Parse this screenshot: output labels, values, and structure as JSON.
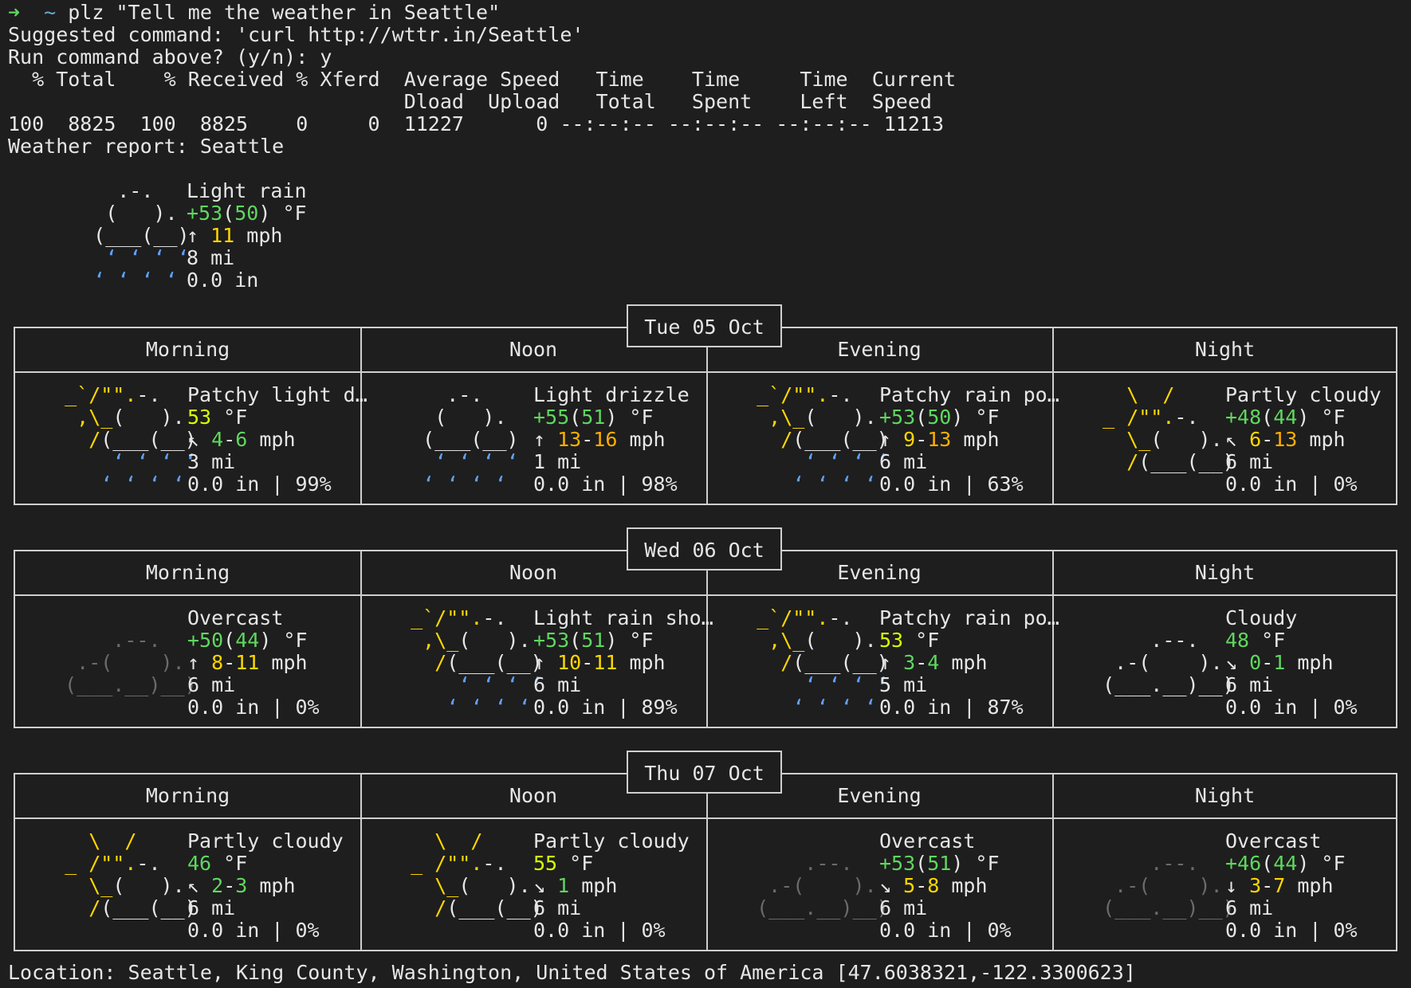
{
  "cmd": {
    "arrow": "➜",
    "tilde": "~",
    "command": "plz \"Tell me the weather in Seattle\"",
    "suggested": "Suggested command: 'curl http://wttr.in/Seattle'",
    "run": "Run command above? (y/n): y"
  },
  "curl": {
    "header1": "  % Total    % Received % Xferd  Average Speed   Time    Time     Time  Current",
    "header2": "                                 Dload  Upload   Total   Spent    Left  Speed",
    "stats": "100  8825  100  8825    0     0  11227      0 --:--:-- --:--:-- --:--:-- 11213"
  },
  "report_title": "Weather report: Seattle",
  "current": {
    "condition": "Light rain",
    "temp": "+53",
    "feels": "50",
    "unit": "°F",
    "wind_arrow": "↑",
    "wind": "11",
    "wind_unit": "mph",
    "visibility": "8 mi",
    "precip": "0.0 in"
  },
  "periods": [
    "Morning",
    "Noon",
    "Evening",
    "Night"
  ],
  "days": [
    {
      "date": "Tue 05 Oct",
      "slots": [
        {
          "condition": "Patchy light d…",
          "temp": "53",
          "feels": "",
          "wind_arrow": "↖",
          "wind_lo": "4",
          "wind_hi": "6",
          "visibility": "3 mi",
          "precip": "0.0 in | 99%"
        },
        {
          "condition": "Light drizzle",
          "temp": "+55",
          "feels": "51",
          "wind_arrow": "↑",
          "wind_lo": "13",
          "wind_hi": "16",
          "visibility": "1 mi",
          "precip": "0.0 in | 98%"
        },
        {
          "condition": "Patchy rain po…",
          "temp": "+53",
          "feels": "50",
          "wind_arrow": "↑",
          "wind_lo": "9",
          "wind_hi": "13",
          "visibility": "6 mi",
          "precip": "0.0 in | 63%"
        },
        {
          "condition": "Partly cloudy",
          "temp": "+48",
          "feels": "44",
          "wind_arrow": "↖",
          "wind_lo": "6",
          "wind_hi": "13",
          "visibility": "6 mi",
          "precip": "0.0 in | 0%"
        }
      ]
    },
    {
      "date": "Wed 06 Oct",
      "slots": [
        {
          "condition": "Overcast",
          "temp": "+50",
          "feels": "44",
          "wind_arrow": "↑",
          "wind_lo": "8",
          "wind_hi": "11",
          "visibility": "6 mi",
          "precip": "0.0 in | 0%"
        },
        {
          "condition": "Light rain sho…",
          "temp": "+53",
          "feels": "51",
          "wind_arrow": "↑",
          "wind_lo": "10",
          "wind_hi": "11",
          "visibility": "6 mi",
          "precip": "0.0 in | 89%"
        },
        {
          "condition": "Patchy rain po…",
          "temp": "53",
          "feels": "",
          "wind_arrow": "↑",
          "wind_lo": "3",
          "wind_hi": "4",
          "visibility": "5 mi",
          "precip": "0.0 in | 87%"
        },
        {
          "condition": "Cloudy",
          "temp": "48",
          "feels": "",
          "wind_arrow": "↘",
          "wind_lo": "0",
          "wind_hi": "1",
          "visibility": "6 mi",
          "precip": "0.0 in | 0%"
        }
      ]
    },
    {
      "date": "Thu 07 Oct",
      "slots": [
        {
          "condition": "Partly cloudy",
          "temp": "46",
          "feels": "",
          "wind_arrow": "↖",
          "wind_lo": "2",
          "wind_hi": "3",
          "visibility": "6 mi",
          "precip": "0.0 in | 0%"
        },
        {
          "condition": "Partly cloudy",
          "temp": "55",
          "feels": "",
          "wind_arrow": "↘",
          "wind_lo": "1",
          "wind_hi": "",
          "visibility": "6 mi",
          "precip": "0.0 in | 0%"
        },
        {
          "condition": "Overcast",
          "temp": "+53",
          "feels": "51",
          "wind_arrow": "↘",
          "wind_lo": "5",
          "wind_hi": "8",
          "visibility": "6 mi",
          "precip": "0.0 in | 0%"
        },
        {
          "condition": "Overcast",
          "temp": "+46",
          "feels": "44",
          "wind_arrow": "↓",
          "wind_lo": "3",
          "wind_hi": "7",
          "visibility": "6 mi",
          "precip": "0.0 in | 0%"
        }
      ]
    }
  ],
  "location": "Location: Seattle, King County, Washington, United States of America [47.6038321,-122.3300623]"
}
